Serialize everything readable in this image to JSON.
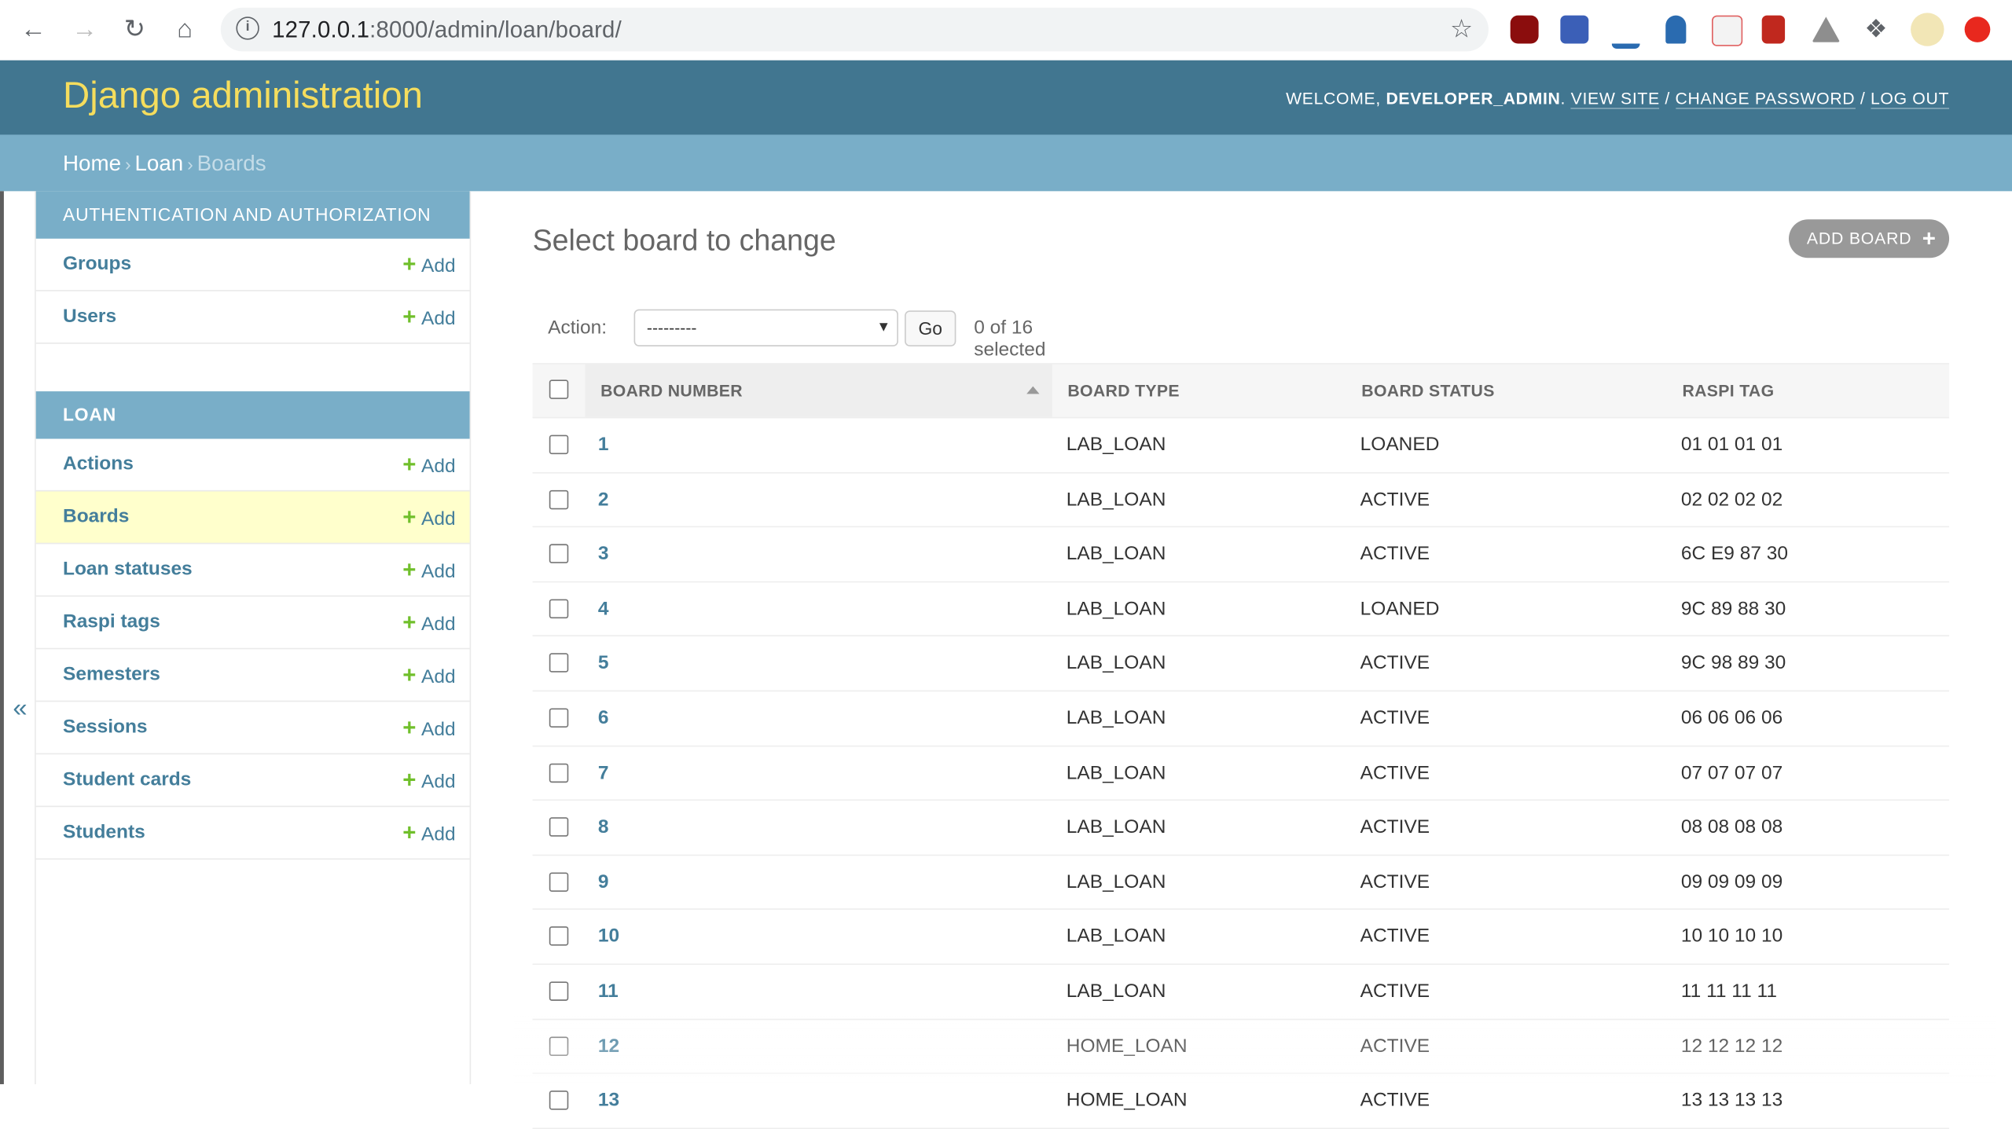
{
  "browser": {
    "url_host": "127.0.0.1",
    "url_rest": ":8000/admin/loan/board/",
    "extensions": [
      "ublock-icon",
      "ext-checker-icon",
      "download-icon",
      "arrow-down-icon",
      "pdf-icon",
      "book-icon",
      "drive-icon",
      "puzzle-icon",
      "profile-avatar",
      "update-icon"
    ]
  },
  "header": {
    "brand": "Django administration",
    "welcome": "Welcome,",
    "user": "developer_admin",
    "view_site": "View site",
    "change_password": "Change password",
    "log_out": "Log out"
  },
  "breadcrumbs": {
    "home": "Home",
    "loan": "Loan",
    "current": "Boards"
  },
  "sidebar": {
    "toggle": "«",
    "auth": {
      "caption": "Authentication and Authorization",
      "items": [
        {
          "name": "Groups",
          "add": "Add"
        },
        {
          "name": "Users",
          "add": "Add"
        }
      ]
    },
    "loan": {
      "caption": "Loan",
      "items": [
        {
          "name": "Actions",
          "add": "Add"
        },
        {
          "name": "Boards",
          "add": "Add"
        },
        {
          "name": "Loan statuses",
          "add": "Add"
        },
        {
          "name": "Raspi tags",
          "add": "Add"
        },
        {
          "name": "Semesters",
          "add": "Add"
        },
        {
          "name": "Sessions",
          "add": "Add"
        },
        {
          "name": "Student cards",
          "add": "Add"
        },
        {
          "name": "Students",
          "add": "Add"
        }
      ]
    }
  },
  "main": {
    "title": "Select board to change",
    "add_button": "Add board",
    "action_label": "Action:",
    "action_value": "---------",
    "go": "Go",
    "counter": "0 of 16 selected",
    "columns": [
      "Board number",
      "Board type",
      "Board status",
      "Raspi tag"
    ],
    "rows": [
      {
        "num": "1",
        "type": "LAB_LOAN",
        "status": "LOANED",
        "tag": "01 01 01 01"
      },
      {
        "num": "2",
        "type": "LAB_LOAN",
        "status": "ACTIVE",
        "tag": "02 02 02 02"
      },
      {
        "num": "3",
        "type": "LAB_LOAN",
        "status": "ACTIVE",
        "tag": "6C E9 87 30"
      },
      {
        "num": "4",
        "type": "LAB_LOAN",
        "status": "LOANED",
        "tag": "9C 89 88 30"
      },
      {
        "num": "5",
        "type": "LAB_LOAN",
        "status": "ACTIVE",
        "tag": "9C 98 89 30"
      },
      {
        "num": "6",
        "type": "LAB_LOAN",
        "status": "ACTIVE",
        "tag": "06 06 06 06"
      },
      {
        "num": "7",
        "type": "LAB_LOAN",
        "status": "ACTIVE",
        "tag": "07 07 07 07"
      },
      {
        "num": "8",
        "type": "LAB_LOAN",
        "status": "ACTIVE",
        "tag": "08 08 08 08"
      },
      {
        "num": "9",
        "type": "LAB_LOAN",
        "status": "ACTIVE",
        "tag": "09 09 09 09"
      },
      {
        "num": "10",
        "type": "LAB_LOAN",
        "status": "ACTIVE",
        "tag": "10 10 10 10"
      },
      {
        "num": "11",
        "type": "LAB_LOAN",
        "status": "ACTIVE",
        "tag": "11 11 11 11"
      },
      {
        "num": "12",
        "type": "HOME_LOAN",
        "status": "ACTIVE",
        "tag": "12 12 12 12"
      },
      {
        "num": "13",
        "type": "HOME_LOAN",
        "status": "ACTIVE",
        "tag": "13 13 13 13"
      }
    ]
  },
  "colors": {
    "header_bg": "#417690",
    "brand": "#f5dd5d",
    "breadcrumbs_bg": "#79aec8",
    "link": "#447e9b",
    "add_green": "#70bf2b",
    "selected_row": "#ffffcc"
  }
}
